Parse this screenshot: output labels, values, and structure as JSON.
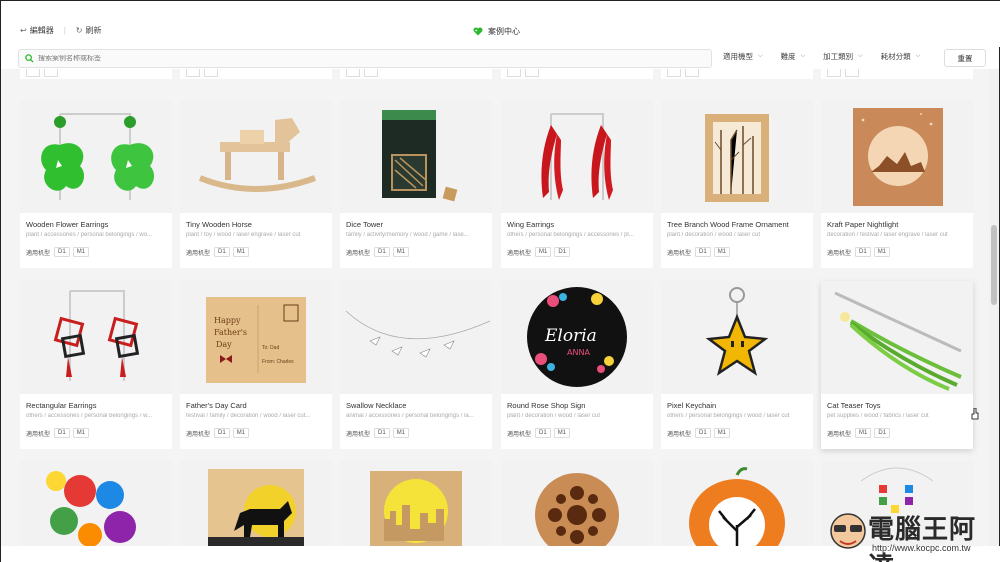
{
  "toolbar": {
    "editor_label": "編輯器",
    "refresh_label": "刷新",
    "center_title": "案例中心"
  },
  "search": {
    "placeholder": "搜索案例名称或标签"
  },
  "filters": [
    {
      "label": "適用機型"
    },
    {
      "label": "難度"
    },
    {
      "label": "加工類別"
    },
    {
      "label": "耗材分類"
    }
  ],
  "reset_label": "重置",
  "model_label": "適用机型",
  "cards": [
    {
      "title": "Wooden Flower Earrings",
      "tags": "plant / accessories / personal belongings / wo...",
      "models": [
        "D1",
        "M1"
      ]
    },
    {
      "title": "Tiny Wooden Horse",
      "tags": "plant / toy / wood / laser engrave / laser cut",
      "models": [
        "D1",
        "M1"
      ]
    },
    {
      "title": "Dice Tower",
      "tags": "family / activity/memory / wood / game / lase...",
      "models": [
        "D1",
        "M1"
      ]
    },
    {
      "title": "Wing Earrings",
      "tags": "others / personal belongings / accessories / pl...",
      "models": [
        "M1",
        "D1"
      ]
    },
    {
      "title": "Tree Branch Wood Frame Ornament",
      "tags": "plant / decoration / wood / laser cut",
      "models": [
        "D1",
        "M1"
      ]
    },
    {
      "title": "Kraft Paper Nightlight",
      "tags": "decoration / festival / laser engrave / laser cut",
      "models": [
        "D1",
        "M1"
      ]
    },
    {
      "title": "Rectangular Earrings",
      "tags": "others / accessories / personal belongings / w...",
      "models": [
        "D1",
        "M1"
      ]
    },
    {
      "title": "Father's Day Card",
      "tags": "festival / family / decoration / wood / laser cut...",
      "models": [
        "D1",
        "M1"
      ]
    },
    {
      "title": "Swallow Necklace",
      "tags": "animal / accessories / personal belongings / la...",
      "models": [
        "D1",
        "M1"
      ]
    },
    {
      "title": "Round Rose Shop Sign",
      "tags": "plant / decoration / wood / laser cut",
      "models": [
        "D1",
        "M1"
      ]
    },
    {
      "title": "Pixel Keychain",
      "tags": "others / personal belongings / wood / laser cut",
      "models": [
        "D1",
        "M1"
      ]
    },
    {
      "title": "Cat Teaser Toys",
      "tags": "pet supplies / wood / fabrics / laser cut",
      "models": [
        "M1",
        "D1"
      ]
    }
  ],
  "card_art": {
    "postcard_happy": "Happy",
    "postcard_fathers": "Father's",
    "postcard_day": "Day",
    "postcard_to": "To: Dad",
    "postcard_from": "From: Charles",
    "sign_name": "Eloria",
    "sign_sub": "ANNA"
  },
  "watermark": {
    "text": "電腦王阿達",
    "url": "http://www.kocpc.com.tw"
  },
  "colors": {
    "brand_green": "#2eb82e",
    "heart_green": "#2eb82e"
  }
}
